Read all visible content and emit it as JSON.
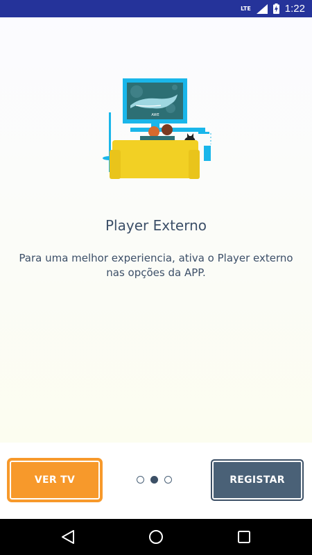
{
  "status_bar": {
    "network_label": "LTE",
    "time": "1:22",
    "icons": [
      "signal-icon",
      "battery-charging-icon"
    ]
  },
  "slide": {
    "title": "Player Externo",
    "description": "Para uma melhor experiencia, ativa o Player externo nas opções da APP.",
    "tv_screen_text": "AWE",
    "illustration": "couch-tv-illustration"
  },
  "actions": {
    "left_button": "VER TV",
    "right_button": "REGISTAR"
  },
  "pager": {
    "total": 3,
    "current": 2
  },
  "navigation": {
    "icons": [
      "back-icon",
      "home-icon",
      "recents-icon"
    ]
  },
  "colors": {
    "status_bar": "#25339a",
    "accent_orange": "#f7992b",
    "dark_slate": "#4a6177",
    "text": "#3c4f68",
    "tv_cyan": "#1ab6ea",
    "couch_yellow": "#f2d024"
  }
}
